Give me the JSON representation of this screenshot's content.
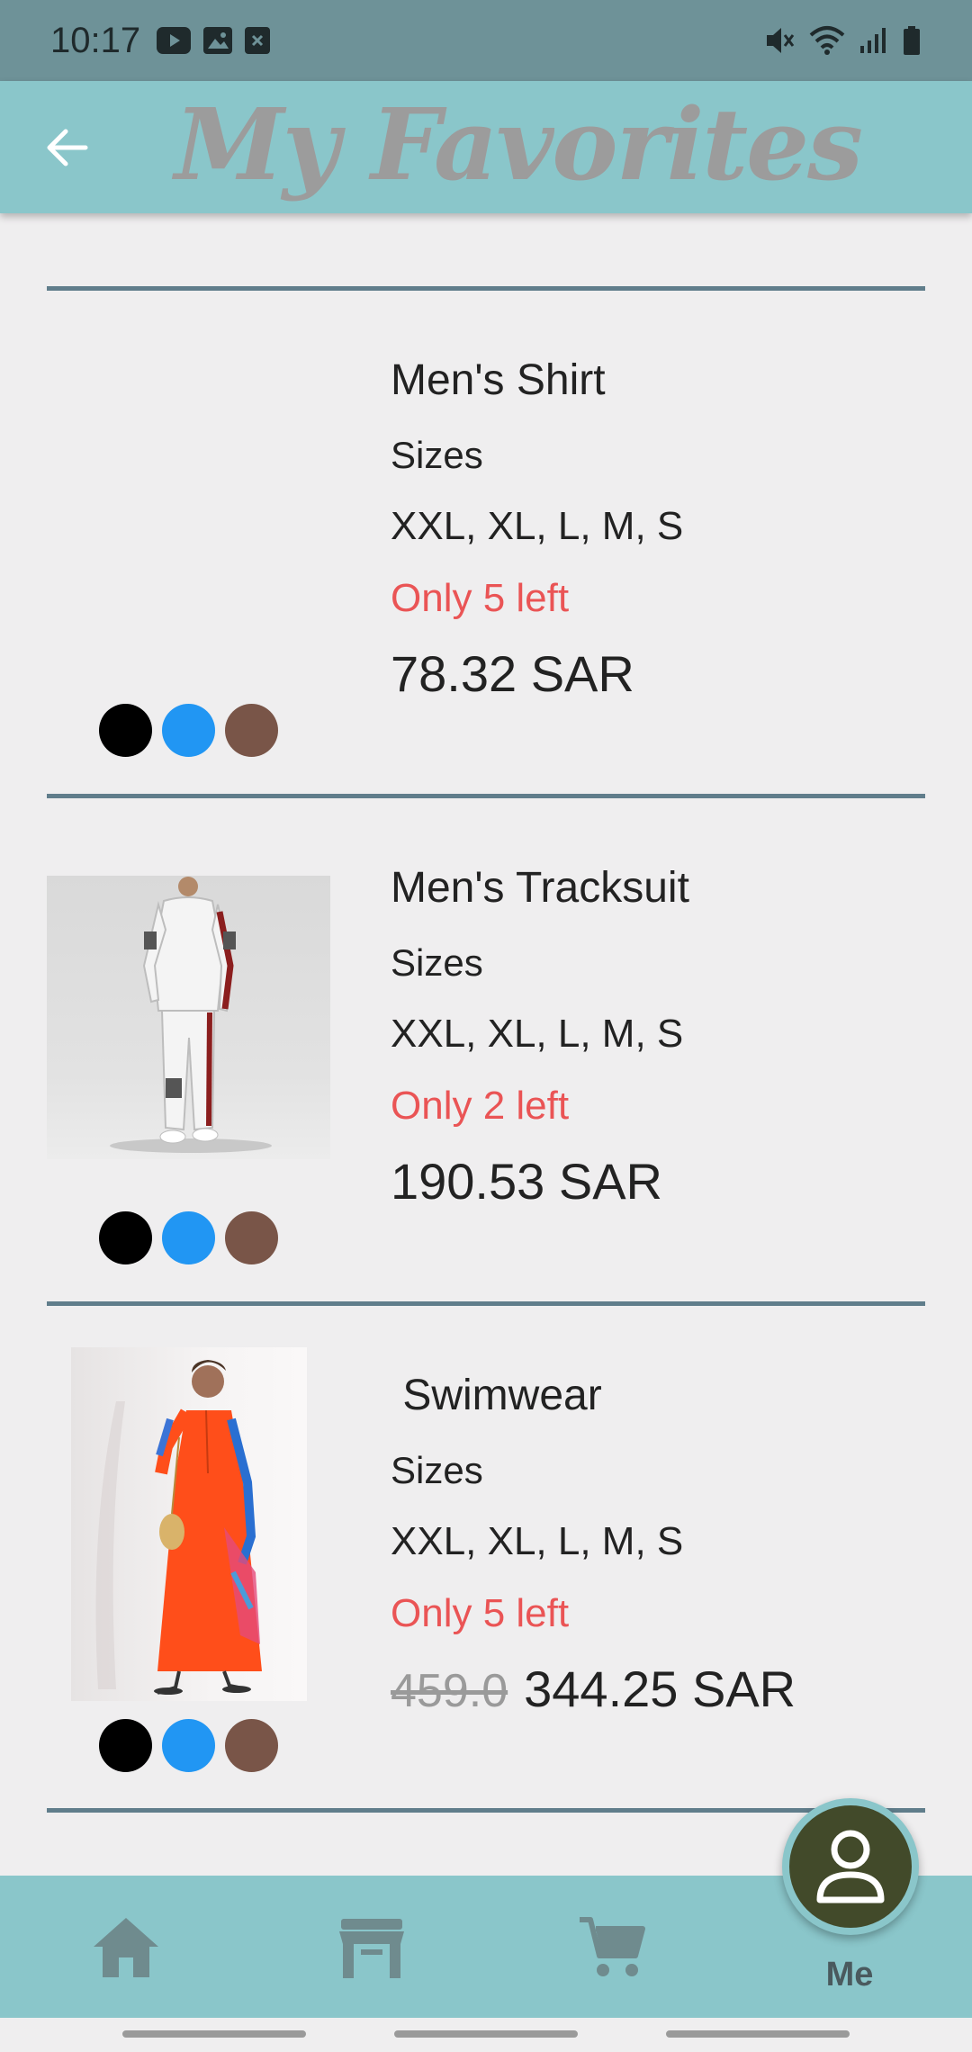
{
  "status_bar": {
    "time": "10:17",
    "left_icons": [
      "youtube-icon",
      "image-icon",
      "close-box-icon"
    ],
    "right_icons": [
      "mute-icon",
      "wifi-icon",
      "signal-icon",
      "battery-icon"
    ]
  },
  "app_bar": {
    "title": "My Favorites",
    "back_icon": "arrow-back-icon"
  },
  "items": [
    {
      "name": "Men's Shirt",
      "sizes_label": "Sizes",
      "sizes": "XXL, XL, L, M, S",
      "stock": "Only 5 left",
      "price": "78.32 SAR",
      "old_price": "",
      "image": "none",
      "colors": [
        "#000000",
        "#2196F3",
        "#795548"
      ]
    },
    {
      "name": "Men's Tracksuit",
      "sizes_label": "Sizes",
      "sizes": "XXL, XL, L, M, S",
      "stock": "Only 2 left",
      "price": "190.53 SAR",
      "old_price": "",
      "image": "tracksuit-photo",
      "colors": [
        "#000000",
        "#2196F3",
        "#795548"
      ]
    },
    {
      "name": " Swimwear",
      "sizes_label": "Sizes",
      "sizes": "XXL, XL, L, M, S",
      "stock": "Only 5 left",
      "price": "344.25 SAR",
      "old_price": "459.0",
      "image": "swimwear-photo",
      "colors": [
        "#000000",
        "#2196F3",
        "#795548"
      ]
    }
  ],
  "bottom_nav": {
    "items": [
      {
        "icon": "home-icon"
      },
      {
        "icon": "store-icon"
      },
      {
        "icon": "cart-icon"
      },
      {
        "icon": "person-icon",
        "label": "Me"
      }
    ]
  },
  "colors": {
    "app_bar": "#8AC6CA",
    "status_bar": "#6E9298",
    "stock_text": "#EA5455",
    "divider": "#607D8B",
    "fab": "#424A2A"
  }
}
